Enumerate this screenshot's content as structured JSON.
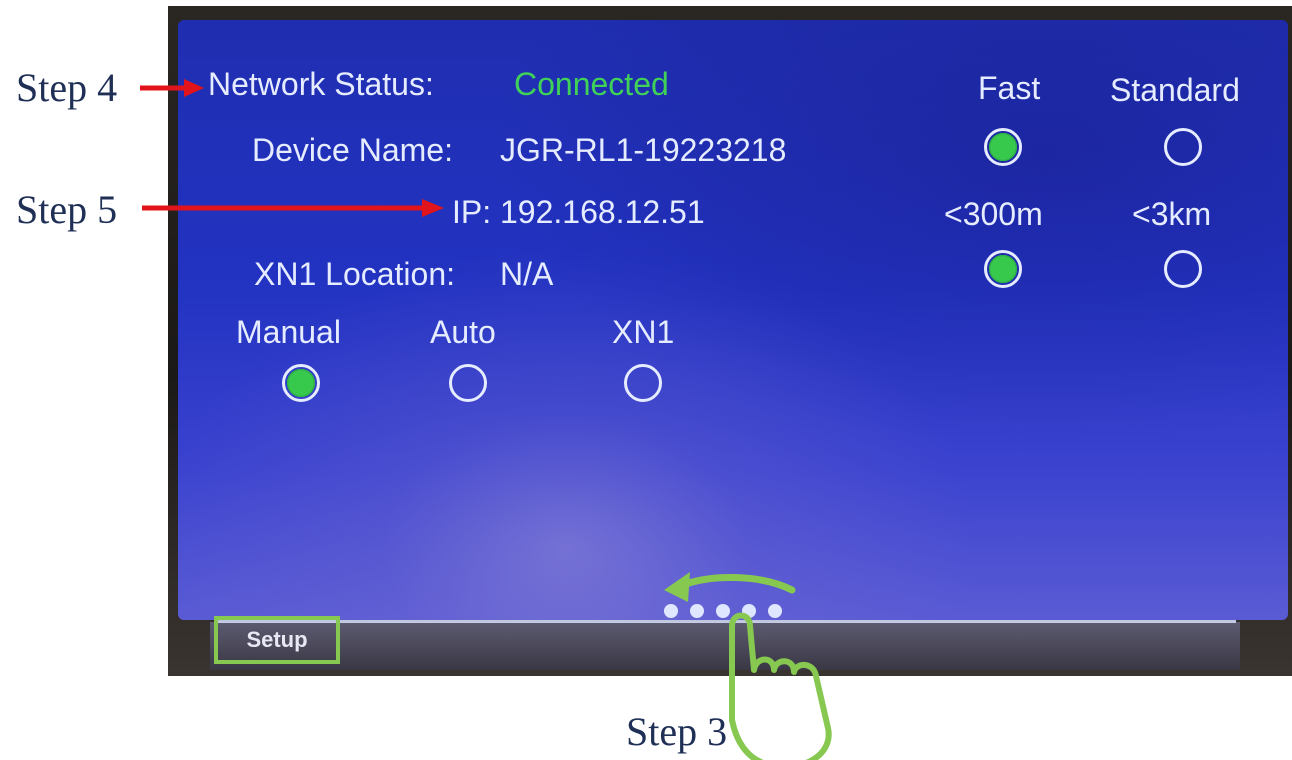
{
  "annotations": {
    "step4_label": "Step 4",
    "step5_label": "Step 5",
    "step3_label": "Step 3",
    "arrow_color": "#e0141a",
    "gesture_color": "#86c850"
  },
  "network": {
    "status_label": "Network Status:",
    "status_value": "Connected",
    "device_name_label": "Device Name:",
    "device_name_value": "JGR-RL1-19223218",
    "ip_label": "IP:",
    "ip_value": "192.168.12.51",
    "xn1_location_label": "XN1 Location:",
    "xn1_location_value": "N/A"
  },
  "speed": {
    "fast_label": "Fast",
    "standard_label": "Standard",
    "selected": "Fast"
  },
  "range": {
    "short_label": "<300m",
    "long_label": "<3km",
    "selected": "<300m"
  },
  "location_mode": {
    "manual_label": "Manual",
    "auto_label": "Auto",
    "xn1_label": "XN1",
    "selected": "Manual"
  },
  "footer": {
    "setup_tab_label": "Setup",
    "page_indicator_count": 5,
    "swipe_direction": "left"
  },
  "colors": {
    "screen_background": "#2333c2",
    "text": "#e6ecff",
    "connected_green": "#3fd158",
    "radio_selected_green": "#37c94c"
  }
}
